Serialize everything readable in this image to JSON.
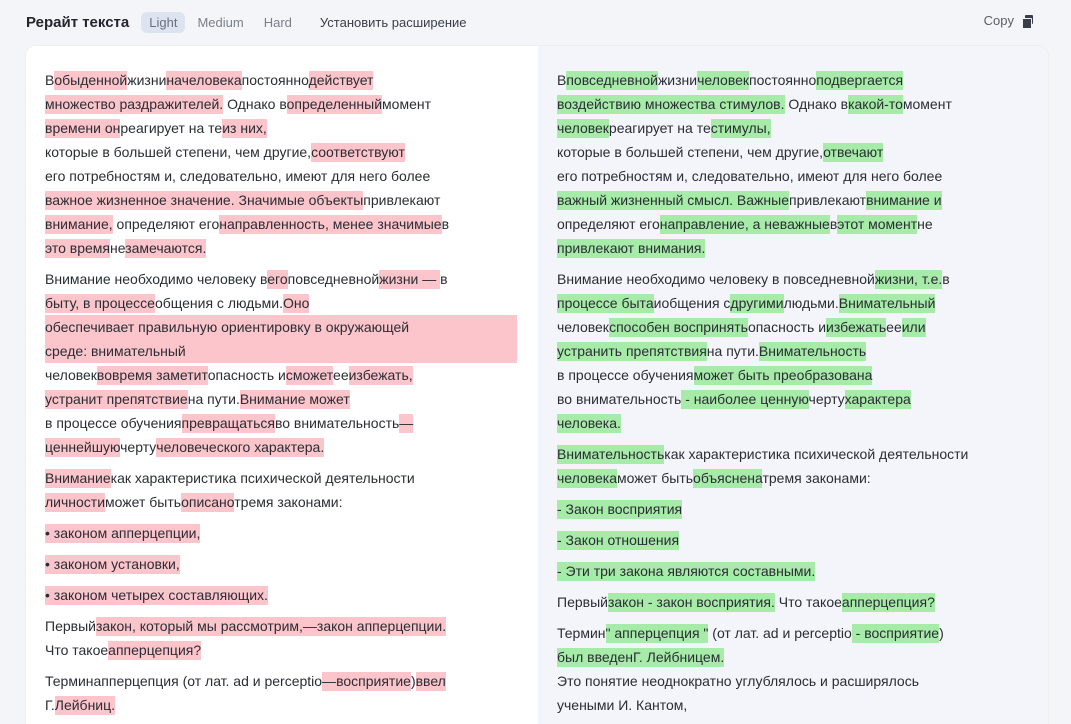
{
  "header": {
    "title": "Рерайт текста",
    "tabs": [
      "Light",
      "Medium",
      "Hard"
    ],
    "active_tab": "Light",
    "install_label": "Установить расширение",
    "copy_label": "Copy"
  },
  "colors": {
    "removed": "#fbc5cb",
    "added": "#a7eba9",
    "panel_right": "#f4f5fb"
  },
  "original": [
    [
      [
        [
          "В",
          0
        ],
        [
          "обыденной",
          1
        ],
        [
          "жизни",
          0
        ],
        [
          "на",
          1
        ],
        [
          "человека",
          1
        ],
        [
          "постоянно",
          0
        ],
        [
          "действует",
          1
        ]
      ],
      [
        [
          "множество раздражителей.",
          1
        ],
        [
          " Однако в",
          0
        ],
        [
          "определенный",
          1
        ],
        [
          "момент",
          0
        ]
      ],
      [
        [
          "времени он",
          1
        ],
        [
          "реагирует на те",
          0
        ],
        [
          "из них,",
          1
        ]
      ],
      [
        [
          "которые в большей степени, чем другие,",
          0
        ],
        [
          "соответствуют",
          1
        ]
      ],
      [
        [
          "его потребностям и, следовательно, имеют для него более",
          0
        ]
      ],
      [
        [
          "важное жизненное значение. Значимые объекты",
          1
        ],
        [
          "привлекают",
          0
        ]
      ],
      [
        [
          "внимание,",
          1
        ],
        [
          " определяют его",
          0
        ],
        [
          "направленность, менее значимые",
          1
        ],
        [
          "в",
          0
        ]
      ],
      [
        [
          "это время",
          1
        ],
        [
          "не",
          0
        ],
        [
          "замечаются.",
          1
        ]
      ]
    ],
    [
      [
        [
          "Внимание необходимо человеку в",
          0
        ],
        [
          "его",
          1
        ],
        [
          "повседневной",
          0
        ],
        [
          "жизни — ",
          1
        ],
        [
          "в",
          0
        ]
      ],
      [
        [
          "быту, в процессе",
          1
        ],
        [
          "общения с людьми.",
          0
        ],
        [
          "Оно",
          1
        ]
      ],
      [
        [
          "обеспечивает правильную ориентировку в окружающей",
          2
        ]
      ],
      [
        [
          "среде: внимательный",
          2
        ]
      ],
      [
        [
          "человек",
          0
        ],
        [
          "вовремя заметит",
          1
        ],
        [
          "опасность и",
          0
        ],
        [
          "сможет",
          1
        ],
        [
          "ее",
          0
        ],
        [
          "избежать,",
          1
        ]
      ],
      [
        [
          "устранит препятствие",
          1
        ],
        [
          "на пути.",
          0
        ],
        [
          "Внимание может",
          1
        ]
      ],
      [
        [
          "в процессе обучения",
          0
        ],
        [
          "превращаться",
          1
        ],
        [
          "во внимательность",
          0
        ],
        [
          "—",
          1
        ]
      ],
      [
        [
          "ценнейшую",
          1
        ],
        [
          "черту",
          0
        ],
        [
          "человеческого характера.",
          1
        ]
      ]
    ],
    [
      [
        [
          "Внимание",
          1
        ],
        [
          "как характеристика психической деятельности",
          0
        ]
      ],
      [
        [
          "личности",
          1
        ],
        [
          "может быть",
          0
        ],
        [
          "описано",
          1
        ],
        [
          "тремя законами:",
          0
        ]
      ]
    ],
    [
      [
        [
          "• законом апперцепции,",
          1
        ]
      ]
    ],
    [
      [
        [
          "• законом установки,",
          1
        ]
      ]
    ],
    [
      [
        [
          "• законом четырех составляющих.",
          1
        ]
      ]
    ],
    [
      [
        [
          "Первый",
          0
        ],
        [
          "закон, который мы рассмотрим,—закон апперцепции.",
          1
        ]
      ],
      [
        [
          "Что такое",
          0
        ],
        [
          "апперцепция?",
          1
        ]
      ]
    ],
    [
      [
        [
          "Термин",
          0
        ],
        [
          "апперцепция",
          0
        ],
        [
          " (от лат. ad и perceptio",
          0
        ],
        [
          "—восприятие",
          1
        ],
        [
          ")",
          0
        ],
        [
          "ввел",
          1
        ]
      ],
      [
        [
          "Г.",
          0
        ],
        [
          "Лейбниц.",
          1
        ]
      ]
    ]
  ],
  "rewritten": [
    [
      [
        [
          "В",
          0
        ],
        [
          "повседневной",
          1
        ],
        [
          "жизни",
          0
        ],
        [
          "человек",
          1
        ],
        [
          "постоянно",
          0
        ],
        [
          "подвергается",
          1
        ]
      ],
      [
        [
          "воздействию множества стимулов.",
          1
        ],
        [
          " Однако в",
          0
        ],
        [
          "какой-то",
          1
        ],
        [
          "момент",
          0
        ]
      ],
      [
        [
          "человек",
          1
        ],
        [
          "реагирует на те",
          0
        ],
        [
          "стимулы,",
          1
        ]
      ],
      [
        [
          "которые в большей степени, чем другие,",
          0
        ],
        [
          "отвечают",
          1
        ]
      ],
      [
        [
          "его потребностям и, следовательно, имеют для него более",
          0
        ]
      ],
      [
        [
          "важный жизненный смысл. Важные",
          1
        ],
        [
          "привлекают",
          0
        ],
        [
          "внимание и",
          1
        ]
      ],
      [
        [
          "определяют его",
          0
        ],
        [
          "направление, а неважные",
          1
        ],
        [
          "в",
          0
        ],
        [
          "этот момент",
          1
        ],
        [
          "не",
          0
        ]
      ],
      [
        [
          "привлекают внимания.",
          1
        ]
      ]
    ],
    [
      [
        [
          "Внимание необходимо человеку в повседневной",
          0
        ],
        [
          "жизни, т.е.",
          1
        ],
        [
          "в",
          0
        ]
      ],
      [
        [
          "процессе быта",
          1
        ],
        [
          "и",
          0
        ],
        [
          "общения с",
          0
        ],
        [
          "другими",
          1
        ],
        [
          "людьми.",
          0
        ],
        [
          "Внимательный",
          1
        ]
      ],
      [
        [
          "человек",
          0
        ],
        [
          "способен воспринять",
          1
        ],
        [
          "опасность и",
          0
        ],
        [
          "избежать",
          1
        ],
        [
          "ее",
          0
        ],
        [
          "или",
          1
        ]
      ],
      [
        [
          "устранить препятствия",
          1
        ],
        [
          "на пути.",
          0
        ],
        [
          "Внимательность",
          1
        ]
      ],
      [
        [
          "в процессе обучения",
          0
        ],
        [
          "может быть преобразована",
          1
        ]
      ],
      [
        [
          "во внимательность",
          0
        ],
        [
          " - наиболее ценную",
          1
        ],
        [
          "черту",
          0
        ],
        [
          "характера",
          1
        ]
      ],
      [
        [
          "человека.",
          1
        ]
      ]
    ],
    [
      [
        [
          "Внимательность",
          1
        ],
        [
          "как характеристика психической деятельности",
          0
        ]
      ],
      [
        [
          "человека",
          1
        ],
        [
          "может быть",
          0
        ],
        [
          "объяснена",
          1
        ],
        [
          "тремя законами:",
          0
        ]
      ]
    ],
    [
      [
        [
          "- Закон восприятия",
          1
        ]
      ]
    ],
    [
      [
        [
          "- Закон отношения",
          1
        ]
      ]
    ],
    [
      [
        [
          "- Эти три закона являются составными.",
          1
        ]
      ]
    ],
    [
      [
        [
          "Первый",
          0
        ],
        [
          "закон - закон восприятия.",
          1
        ],
        [
          " Что такое",
          0
        ],
        [
          "апперцепция?",
          1
        ]
      ]
    ],
    [
      [
        [
          "Термин",
          0
        ],
        [
          "\" апперцепция \"",
          1
        ],
        [
          " (от лат. ad и perceptio",
          0
        ],
        [
          " - восприятие",
          1
        ],
        [
          ")",
          0
        ]
      ],
      [
        [
          "был введен",
          1
        ],
        [
          "Г. Лейбницем.",
          1
        ]
      ],
      [
        [
          "Это понятие неоднократно углублялось и расширялось",
          0
        ]
      ],
      [
        [
          "учеными И. Кантом,",
          0
        ]
      ]
    ]
  ]
}
